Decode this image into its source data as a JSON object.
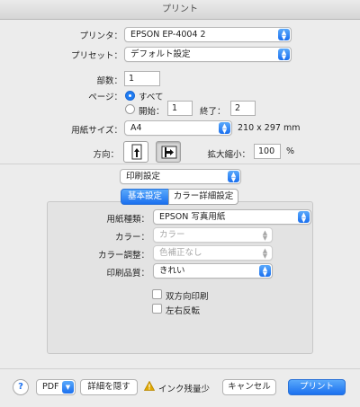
{
  "window": {
    "title": "プリント"
  },
  "printer": {
    "label": "プリンタ：",
    "value": "EPSON EP-4004 2"
  },
  "preset": {
    "label": "プリセット：",
    "value": "デフォルト設定"
  },
  "copies": {
    "label": "部数：",
    "value": "1"
  },
  "pages": {
    "label": "ページ：",
    "all_label": "すべて",
    "from_label": "開始：",
    "from_value": "1",
    "to_label": "終了：",
    "to_value": "2",
    "selected": "all"
  },
  "paper_size": {
    "label": "用紙サイズ：",
    "value": "A4",
    "dimensions": "210 x 297 mm"
  },
  "orientation": {
    "label": "方向：",
    "selected": "landscape"
  },
  "scale": {
    "label": "拡大縮小：",
    "value": "100",
    "unit": "%"
  },
  "section_popup": {
    "value": "印刷設定"
  },
  "tabs": [
    {
      "label": "基本設定",
      "active": true
    },
    {
      "label": "カラー詳細設定",
      "active": false
    }
  ],
  "settings": {
    "media_type": {
      "label": "用紙種類：",
      "value": "EPSON 写真用紙"
    },
    "color": {
      "label": "カラー：",
      "value": "カラー"
    },
    "color_adjust": {
      "label": "カラー調整：",
      "value": "色補正なし"
    },
    "quality": {
      "label": "印刷品質：",
      "value": "きれい"
    },
    "bidirectional": {
      "label": "双方向印刷",
      "checked": false
    },
    "mirror": {
      "label": "左右反転",
      "checked": false
    }
  },
  "footer": {
    "help": "?",
    "pdf_label": "PDF",
    "hide_details_label": "詳細を隠す",
    "ink_warning": "インク残量少",
    "cancel_label": "キャンセル",
    "print_label": "プリント"
  },
  "colors": {
    "accent": "#1b70ef",
    "warning": "#e0a800"
  }
}
